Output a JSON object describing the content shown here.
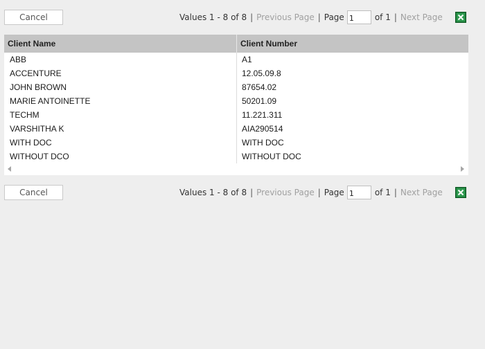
{
  "toolbar_top": {
    "cancel_label": "Cancel",
    "values_label": "Values 1 - 8 of 8",
    "prev_label": "Previous Page",
    "page_label": "Page",
    "page_value": "1",
    "of_label": "of 1",
    "next_label": "Next Page",
    "export_icon": "excel-icon"
  },
  "toolbar_bottom": {
    "cancel_label": "Cancel",
    "values_label": "Values 1 - 8 of 8",
    "prev_label": "Previous Page",
    "page_label": "Page",
    "page_value": "1",
    "of_label": "of 1",
    "next_label": "Next Page",
    "export_icon": "excel-icon"
  },
  "table": {
    "columns": [
      "Client Name",
      "Client Number"
    ],
    "rows": [
      [
        "ABB",
        "A1"
      ],
      [
        "ACCENTURE",
        "12.05.09.8"
      ],
      [
        "JOHN BROWN",
        "87654.02"
      ],
      [
        "MARIE ANTOINETTE",
        "50201.09"
      ],
      [
        "TECHM",
        "11.221.311"
      ],
      [
        "VARSHITHA K",
        "AIA290514"
      ],
      [
        "WITH DOC",
        "WITH DOC"
      ],
      [
        "WITHOUT DCO",
        "WITHOUT DOC"
      ]
    ]
  },
  "colors": {
    "header_bg": "#c4c4c4",
    "disabled_link": "#a0a0a0",
    "excel_green": "#1d7b3a"
  }
}
